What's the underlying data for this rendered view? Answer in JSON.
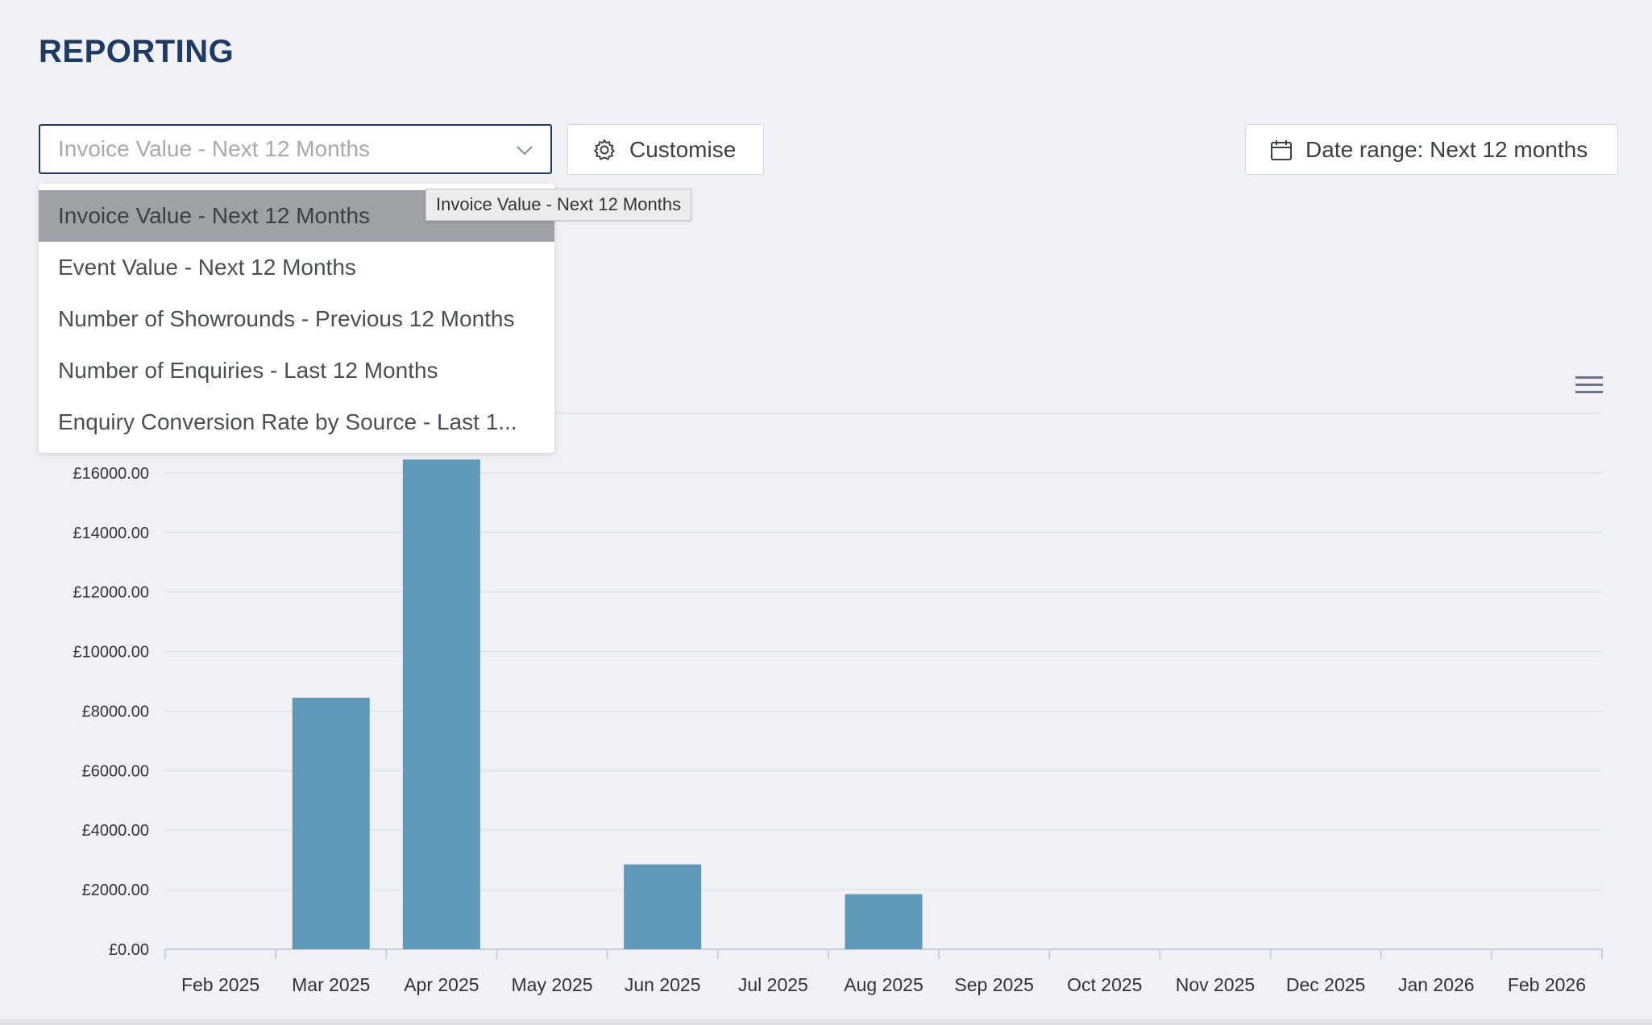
{
  "page": {
    "title": "REPORTING"
  },
  "report_select": {
    "placeholder": "Invoice Value - Next 12 Months",
    "options": [
      "Invoice Value - Next 12 Months",
      "Event Value - Next 12 Months",
      "Number of Showrounds - Previous 12 Months",
      "Number of Enquiries - Last 12 Months",
      "Enquiry Conversion Rate by Source - Last 1..."
    ],
    "selected_index": 0,
    "tooltip": "Invoice Value - Next 12 Months"
  },
  "toolbar": {
    "customise_label": "Customise",
    "date_range_label": "Date range: Next 12 months"
  },
  "icons": {
    "chevron": "chevron-down-icon",
    "gear": "gear-icon",
    "calendar": "calendar-icon",
    "menu": "hamburger-menu-icon"
  },
  "colors": {
    "accent": "#1f3a63",
    "bar": "#6098b8",
    "selected_option_bg": "#9ea2a6"
  },
  "chart_data": {
    "type": "bar",
    "title": "",
    "xlabel": "",
    "ylabel": "",
    "categories": [
      "Feb 2025",
      "Mar 2025",
      "Apr 2025",
      "May 2025",
      "Jun 2025",
      "Jul 2025",
      "Aug 2025",
      "Sep 2025",
      "Oct 2025",
      "Nov 2025",
      "Dec 2025",
      "Jan 2026",
      "Feb 2026"
    ],
    "values": [
      0,
      8450,
      16450,
      0,
      2850,
      0,
      1850,
      0,
      0,
      0,
      0,
      0,
      0
    ],
    "ylim": [
      0,
      18000
    ],
    "yticks": [
      "£0.00",
      "£2000.00",
      "£4000.00",
      "£6000.00",
      "£8000.00",
      "£10000.00",
      "£12000.00",
      "£14000.00",
      "£16000.00"
    ],
    "ytick_values": [
      0,
      2000,
      4000,
      6000,
      8000,
      10000,
      12000,
      14000,
      16000
    ],
    "grid": true,
    "legend": "none"
  }
}
